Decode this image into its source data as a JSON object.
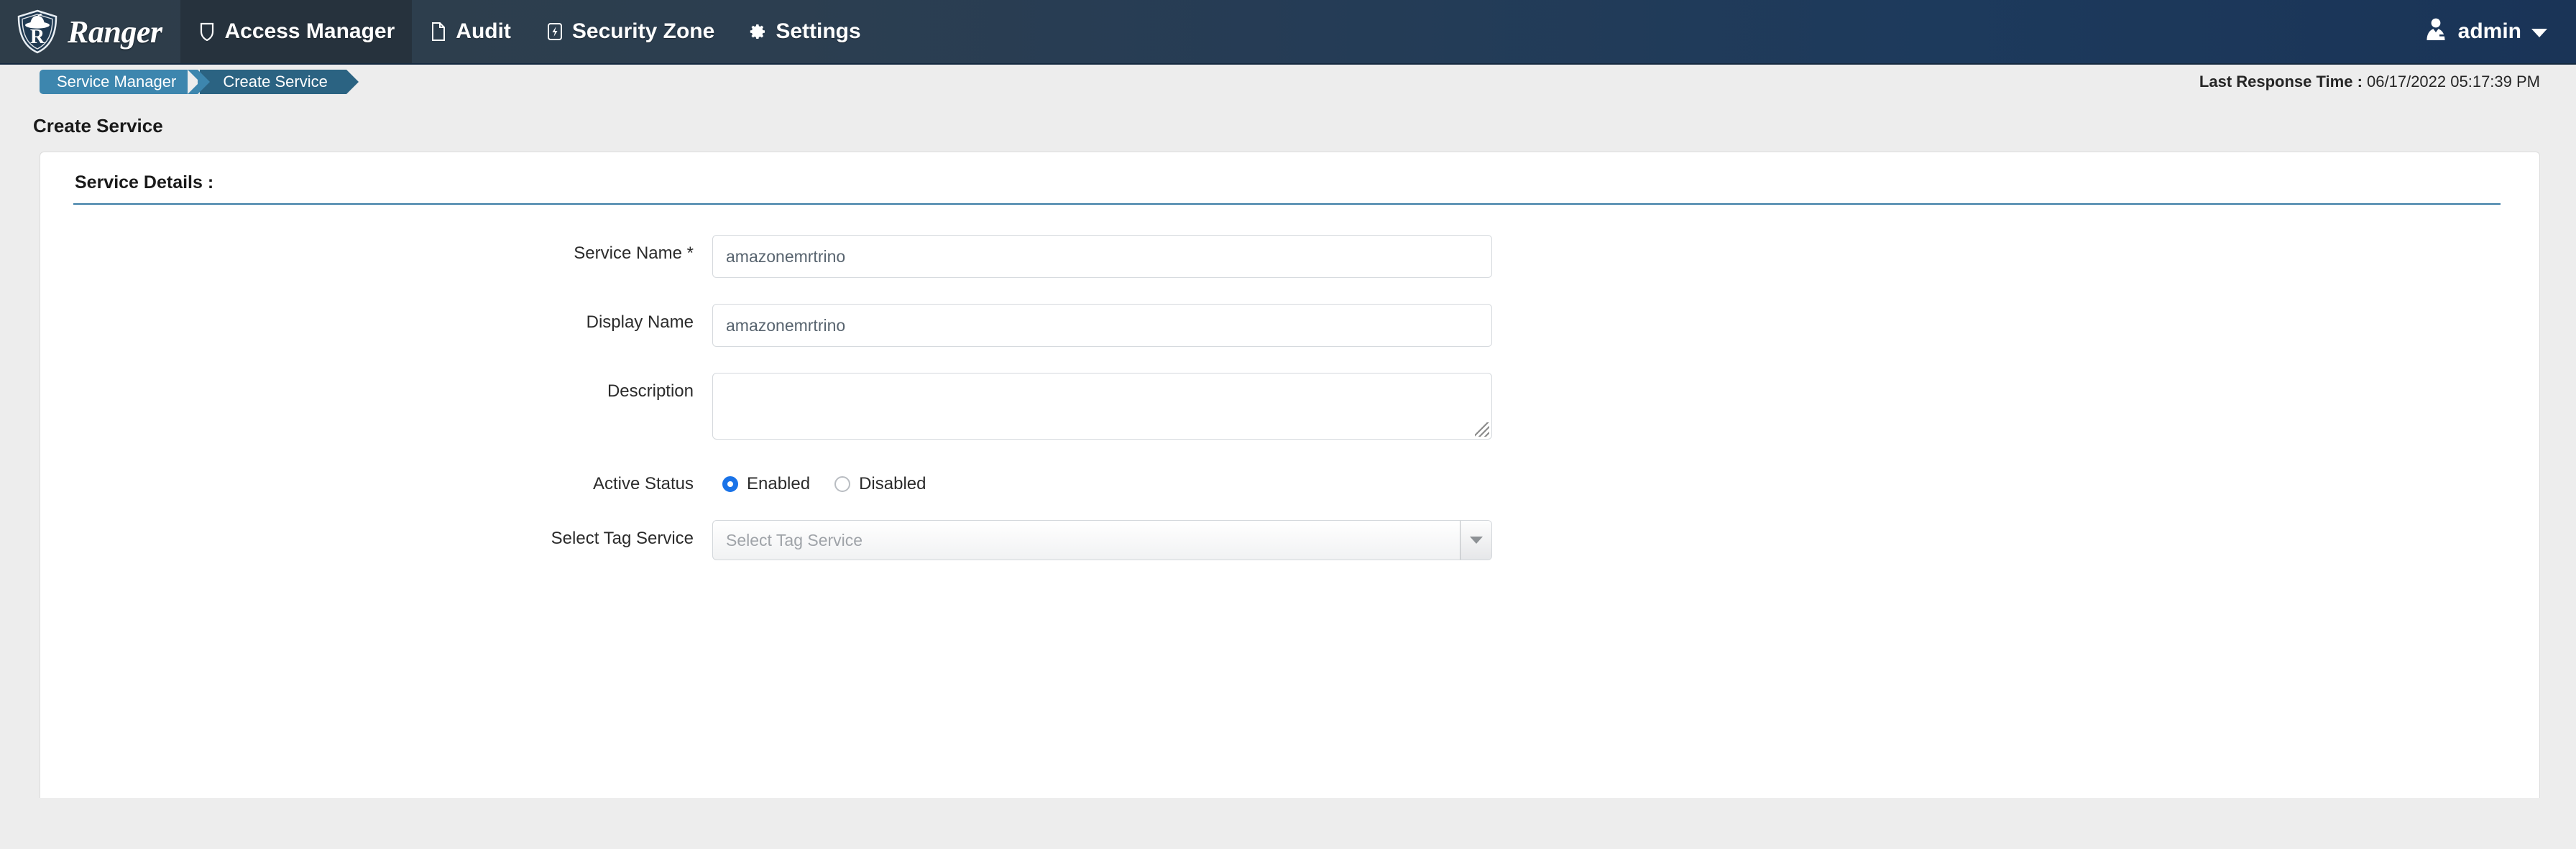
{
  "nav": {
    "brand": "Ranger",
    "brand_logo_icon": "ranger-shield-logo",
    "items": [
      {
        "label": "Access Manager",
        "icon": "shield-icon",
        "active": true
      },
      {
        "label": "Audit",
        "icon": "file-icon",
        "active": false
      },
      {
        "label": "Security Zone",
        "icon": "zone-bolt-icon",
        "active": false
      },
      {
        "label": "Settings",
        "icon": "gear-icon",
        "active": false
      }
    ],
    "user": {
      "name": "admin",
      "icon": "user-avatar-icon",
      "caret": "chevron-down-icon"
    }
  },
  "breadcrumb": {
    "items": [
      {
        "label": "Service Manager"
      },
      {
        "label": "Create Service"
      }
    ],
    "response_time_label": "Last Response Time :",
    "response_time_value": "06/17/2022 05:17:39 PM"
  },
  "page": {
    "title": "Create Service",
    "section_header": "Service Details :"
  },
  "form": {
    "service_name": {
      "label": "Service Name",
      "required_mark": "*",
      "value": "amazonemrtrino",
      "placeholder": ""
    },
    "display_name": {
      "label": "Display Name",
      "value": "amazonemrtrino",
      "placeholder": ""
    },
    "description": {
      "label": "Description",
      "value": "",
      "placeholder": ""
    },
    "active_status": {
      "label": "Active Status",
      "options": [
        {
          "label": "Enabled",
          "selected": true
        },
        {
          "label": "Disabled",
          "selected": false
        }
      ]
    },
    "select_tag_service": {
      "label": "Select Tag Service",
      "placeholder": "Select Tag Service",
      "value": ""
    }
  },
  "colors": {
    "navbar_left": "#2c3e50",
    "navbar_right": "#1a3457",
    "crumb_first": "#3d86ae",
    "crumb_second": "#2b6382",
    "section_underline": "#3a7ca5",
    "radio_selected": "#1a73e8",
    "page_background": "#ededed"
  }
}
